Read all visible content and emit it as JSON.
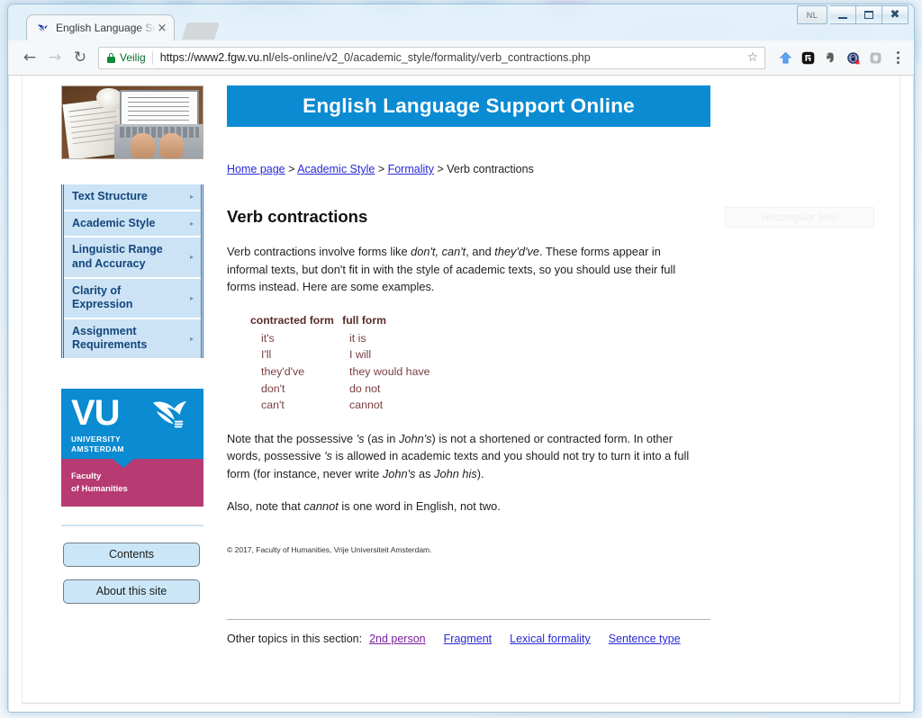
{
  "window": {
    "lang_indicator": "NL",
    "minimize_label": "Minimize",
    "maximize_label": "Maximize",
    "close_label": "Close"
  },
  "browser": {
    "tab": {
      "title": "English Language Suppo",
      "favicon": "vu-griffin-icon",
      "close_glyph": "×"
    },
    "back_glyph": "←",
    "forward_glyph": "→",
    "reload_glyph": "↻",
    "security_label": "Veilig",
    "url_host": "https://www2.fgw.vu.nl",
    "url_path": "/els-online/v2_0/academic_style/formality/verb_contractions.php",
    "star_glyph": "☆",
    "extensions": [
      {
        "name": "blue-arrow-extension-icon"
      },
      {
        "name": "black-g-extension-icon"
      },
      {
        "name": "evernote-extension-icon"
      },
      {
        "name": "lock-blocked-extension-icon"
      },
      {
        "name": "shield-extension-icon"
      }
    ]
  },
  "sidebar": {
    "hero_image_alt": "hands typing on laptop with papers",
    "nav_items": [
      {
        "label": "Text Structure",
        "arrow": "▸"
      },
      {
        "label": "Academic Style",
        "arrow": "▸"
      },
      {
        "label": "Linguistic Range and Accuracy",
        "arrow": "▸"
      },
      {
        "label": "Clarity of Expression",
        "arrow": "▸"
      },
      {
        "label": "Assignment Requirements",
        "arrow": "▸"
      }
    ],
    "logo": {
      "letters": "VU",
      "line1": "UNIVERSITY",
      "line2": "AMSTERDAM",
      "faculty_line1": "Faculty",
      "faculty_line2": "of Humanities"
    },
    "buttons": [
      {
        "label": "Contents"
      },
      {
        "label": "About this site"
      }
    ]
  },
  "main": {
    "banner_title": "English Language Support Online",
    "breadcrumb": {
      "home": "Home page",
      "sep1": " > ",
      "academic_style": "Academic Style",
      "sep2": " > ",
      "formality": "Formality",
      "sep3": " > ",
      "current": "Verb contractions"
    },
    "page_title": "Verb contractions",
    "intro_paragraph": "Verb contractions involve forms like don't, can't, and they'd've. These forms appear in informal texts, but don't fit in with the style of academic texts, so you should use their full forms instead. Here are some examples.",
    "examples": {
      "header_col1": "contracted form",
      "header_col2": "full form",
      "rows": [
        {
          "contracted": "it's",
          "full": "it is"
        },
        {
          "contracted": "I'll",
          "full": "I will"
        },
        {
          "contracted": "they'd've",
          "full": "they would have"
        },
        {
          "contracted": "don't",
          "full": "do not"
        },
        {
          "contracted": "can't",
          "full": "cannot"
        }
      ]
    },
    "note_paragraph": "Note that the possessive 's (as in John's) is not a shortened or contracted form. In other words, possessive 's is allowed in academic texts and you should not try to turn it into a full form (for instance, never write John's as John his).",
    "also_paragraph": "Also, note that cannot is one word in English, not two.",
    "copyright": "© 2017, Faculty of Humanities, Vrije Universiteit Amsterdam.",
    "other_topics_label": "Other topics in this section:",
    "other_topics": [
      {
        "label": "2nd person",
        "state": "visited"
      },
      {
        "label": "Fragment",
        "state": "unvisited"
      },
      {
        "label": "Lexical formality",
        "state": "unvisited"
      },
      {
        "label": "Sentence type",
        "state": "unvisited"
      }
    ]
  },
  "overlay": {
    "snip_tooltip": "Rectangular Snip"
  },
  "colors": {
    "brand_blue": "#0a8bd2",
    "faculty_magenta": "#b83a73",
    "nav_item_bg": "#cbe3f5",
    "nav_text": "#14457c",
    "link_blue": "#2929d6",
    "link_visited": "#7a1f9e",
    "example_text": "#7a3e3e"
  }
}
